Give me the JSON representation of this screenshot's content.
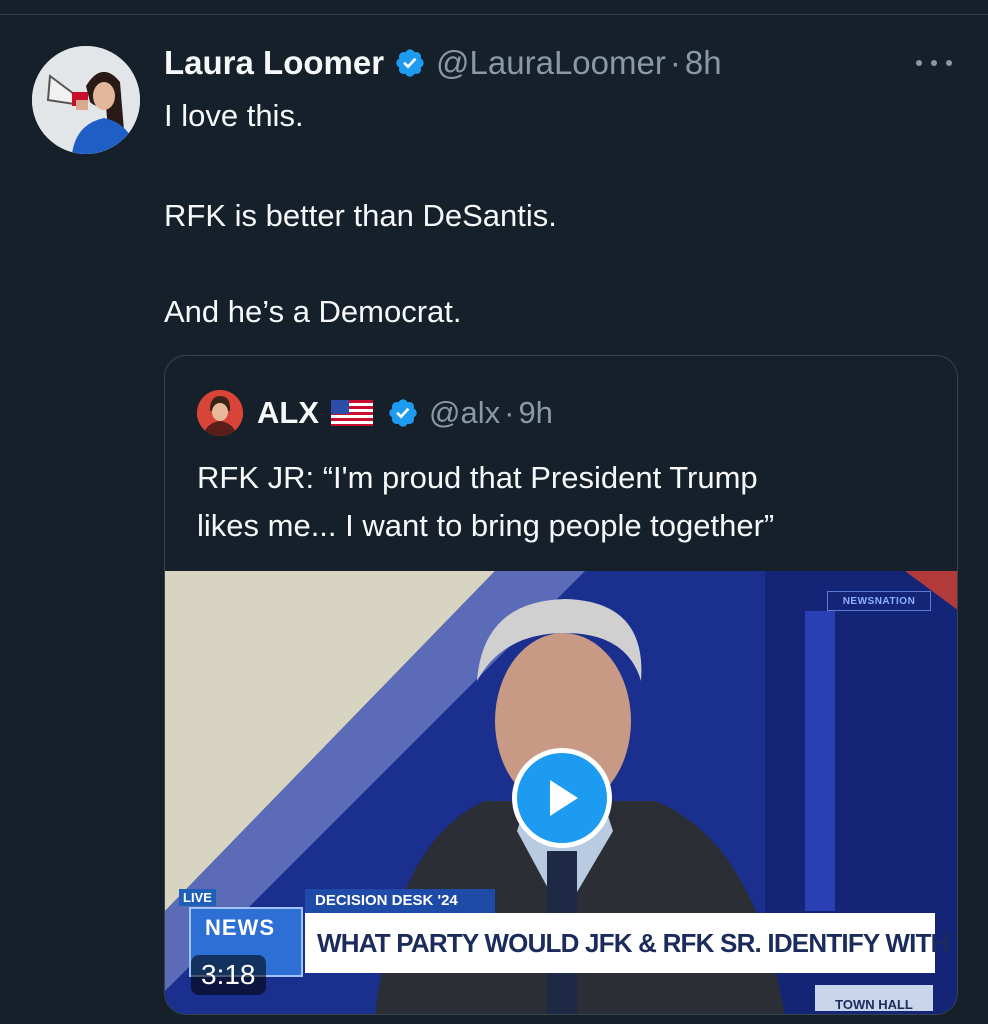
{
  "tweet": {
    "author_name": "Laura Loomer",
    "author_handle": "@LauraLoomer",
    "separator": "·",
    "time": "8h",
    "lines": [
      "I love this.",
      "RFK is better than DeSantis.",
      "And he’s a Democrat."
    ]
  },
  "quoted_tweet": {
    "author_name": "ALX",
    "author_handle": "@alx",
    "separator": "·",
    "time": "9h",
    "lines": [
      "RFK JR: “I'm proud that President Trump",
      "likes me... I want to bring people together”"
    ],
    "video": {
      "duration": "3:18",
      "channel_bug": "NEWSNATION",
      "live_label": "LIVE",
      "news_logo": "NEWS",
      "segment_label": "DECISION DESK '24",
      "headline": "WHAT PARTY WOULD JFK & RFK SR. IDENTIFY WITH TODAY?",
      "corner_badge": "TOWN HALL"
    }
  },
  "icons": {
    "verified": "verified-badge-icon",
    "more": "more-dots-icon",
    "flag": "us-flag-icon",
    "play": "play-icon"
  },
  "colors": {
    "background": "#15202b",
    "text_primary": "#f7f9f9",
    "text_secondary": "#8b98a5",
    "accent": "#1d9bf0",
    "border": "#38444d"
  }
}
